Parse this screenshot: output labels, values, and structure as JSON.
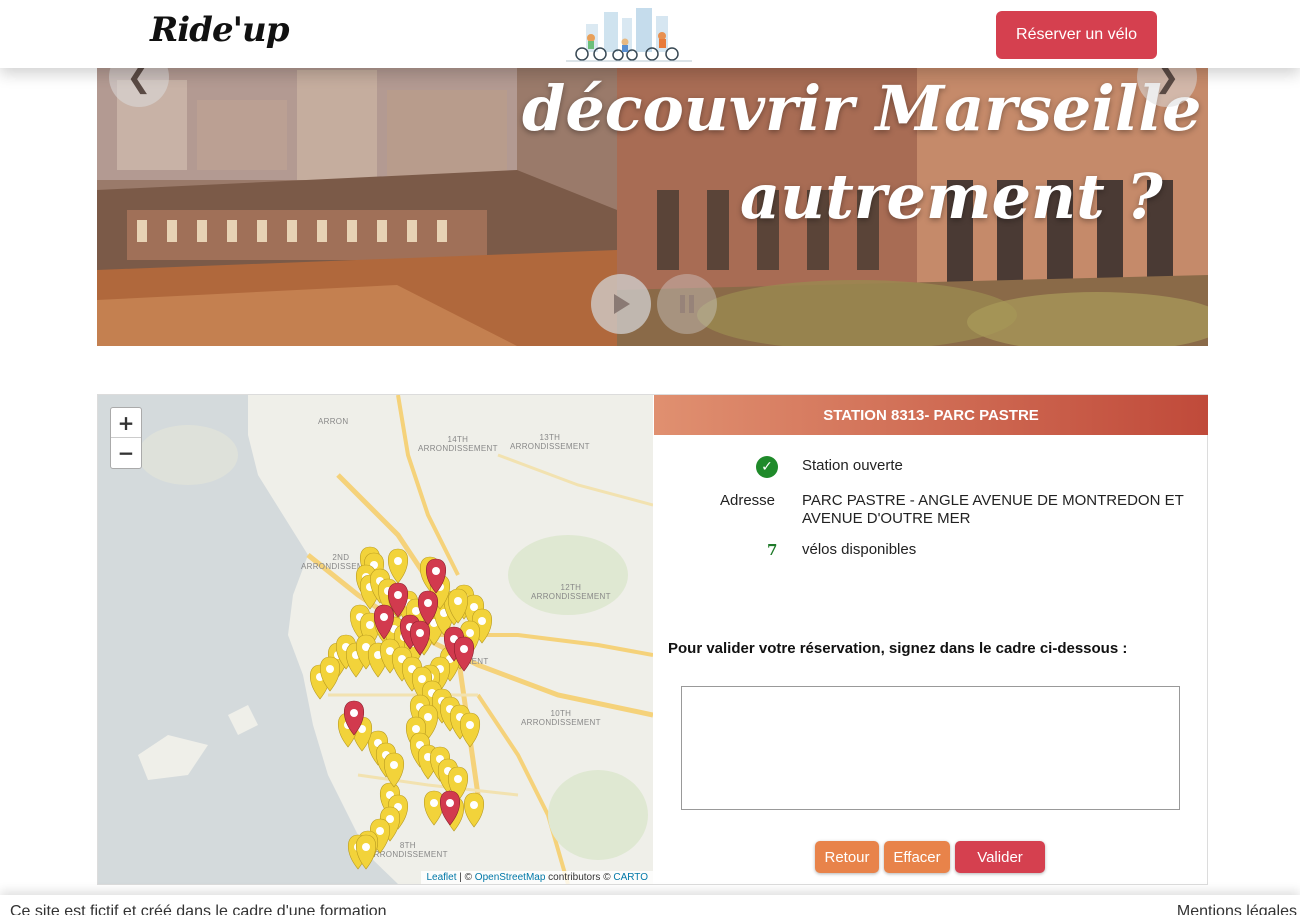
{
  "header": {
    "logo": "Ride'up",
    "reserve_button": "Réserver un vélo"
  },
  "hero": {
    "line1": "découvrir Marseille",
    "line2": "autrement ?",
    "prev_icon": "chevron-left-icon",
    "next_icon": "chevron-right-icon",
    "play_icon": "play-icon",
    "pause_icon": "pause-icon"
  },
  "map": {
    "zoom_in": "+",
    "zoom_out": "−",
    "labels": {
      "arron": "ARRON",
      "a14": "14TH\nARRONDISSEMENT",
      "a13": "13TH\nARRONDISSEMENT",
      "a2": "2ND\nARRONDISSEMENT",
      "a12": "12TH\nARRONDISSEMENT",
      "a6": "EMENT",
      "a10": "10TH\nARRONDISSEMENT",
      "a8": "8TH\nARRONDISSEMENT"
    },
    "attribution": {
      "leaflet": "Leaflet",
      "sep1": " | © ",
      "osm": "OpenStreetMap",
      "mid": " contributors © ",
      "carto": "CARTO"
    },
    "colors": {
      "open_marker": "#f2d33a",
      "closed_marker": "#d23a4e"
    }
  },
  "station": {
    "title": "STATION 8313- PARC PASTRE",
    "status": "Station ouverte",
    "address_label": "Adresse",
    "address": "PARC PASTRE - ANGLE AVENUE DE MONTREDON ET AVENUE D'OUTRE MER",
    "bikes_count": "7",
    "bikes_label": "vélos disponibles"
  },
  "signature": {
    "instruction": "Pour valider votre réservation, signez dans le cadre ci-dessous :"
  },
  "buttons": {
    "retour": "Retour",
    "effacer": "Effacer",
    "valider": "Valider"
  },
  "footer": {
    "left": "Ce site est fictif et créé dans le cadre d'une formation",
    "right": "Mentions légales"
  }
}
